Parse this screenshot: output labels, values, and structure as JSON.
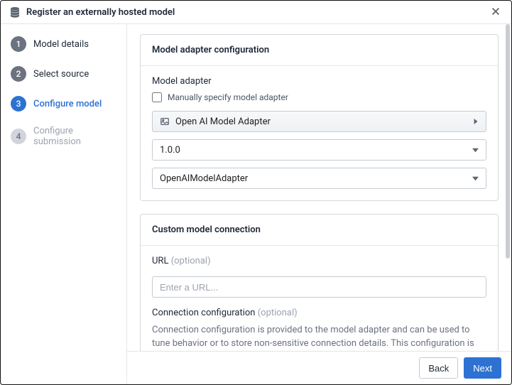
{
  "header": {
    "title": "Register an externally hosted model"
  },
  "sidebar": {
    "steps": [
      {
        "num": "1",
        "label": "Model details",
        "state": "done"
      },
      {
        "num": "2",
        "label": "Select source",
        "state": "done"
      },
      {
        "num": "3",
        "label": "Configure model",
        "state": "active"
      },
      {
        "num": "4",
        "label": "Configure submission",
        "state": "pending"
      }
    ]
  },
  "card_adapter": {
    "title": "Model adapter configuration",
    "field_label": "Model adapter",
    "checkbox_label": "Manually specify model adapter",
    "select_adapter": "Open AI Model Adapter",
    "select_version": "1.0.0",
    "select_class": "OpenAIModelAdapter"
  },
  "card_conn": {
    "title": "Custom model connection",
    "url_label": "URL",
    "url_optional": "(optional)",
    "url_placeholder": "Enter a URL...",
    "cfg_label": "Connection configuration",
    "cfg_optional": "(optional)",
    "cfg_desc": "Connection configuration is provided to the model adapter and can be used to tune behavior or to store non-sensitive connection details. This configuration is visible on"
  },
  "footer": {
    "back": "Back",
    "next": "Next"
  }
}
